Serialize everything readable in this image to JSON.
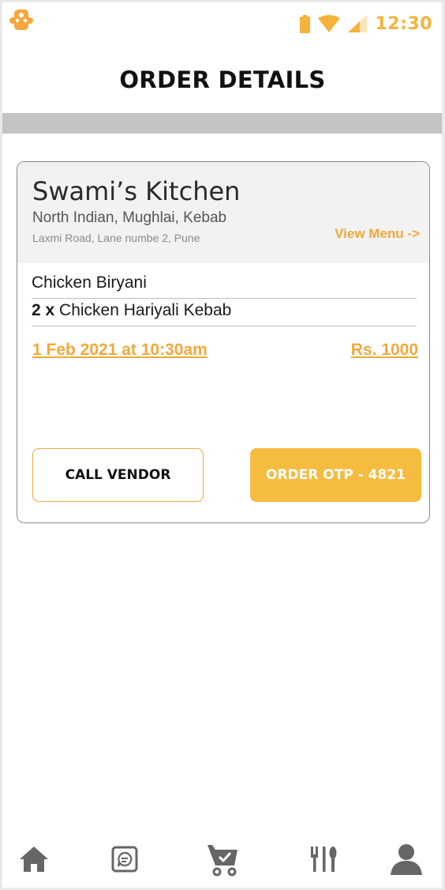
{
  "status_bar": {
    "time": "12:30",
    "icons": [
      "app-logo-icon",
      "battery-icon",
      "wifi-icon",
      "signal-icon"
    ],
    "accent": "#f5b33b"
  },
  "header": {
    "title": "ORDER DETAILS"
  },
  "order": {
    "vendor_name": "Swami’s Kitchen",
    "cuisine": "North Indian, Mughlai, Kebab",
    "address": "Laxmi Road, Lane numbe 2, Pune",
    "view_menu_label": "View Menu ->",
    "items": [
      {
        "qty": "",
        "name": "Chicken Biryani"
      },
      {
        "qty": "2 x",
        "name": "Chicken Hariyali Kebab"
      }
    ],
    "date_time": "1 Feb 2021 at 10:30am",
    "price": "Rs. 1000",
    "call_vendor_label": "CALL VENDOR",
    "otp_label": "ORDER OTP - 4821"
  },
  "bottom_nav": {
    "items": [
      "home-icon",
      "chat-icon",
      "cart-icon",
      "restaurant-icon",
      "profile-icon"
    ],
    "active": "cart-icon"
  },
  "colors": {
    "accent": "#f0a93a",
    "button_fill": "#f5bc3f",
    "icon_gray": "#666666"
  }
}
